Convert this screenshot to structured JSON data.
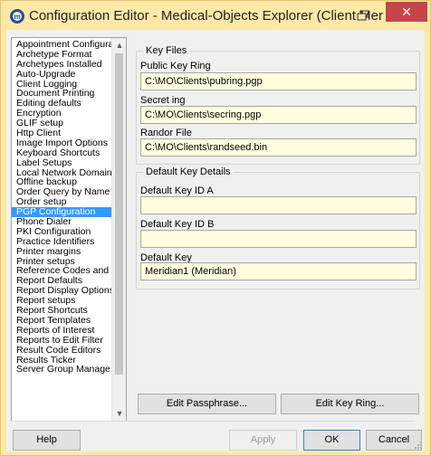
{
  "window": {
    "title": "Configuration Editor - Medical-Objects Explorer (Client Meridia...",
    "close_glyph": "✕"
  },
  "list": {
    "items": [
      "Appointment Configura",
      "Archetype Format",
      "Archetypes Installed",
      "Auto-Upgrade",
      "Client Logging",
      "Document Printing",
      "Editing defaults",
      "Encryption",
      "GLIF setup",
      "Http Client",
      "Image Import Options",
      "Keyboard Shortcuts",
      "Label Setups",
      "Local Network Domain",
      "Offline backup",
      "Order Query by Name",
      "Order setup",
      "PGP Configuration",
      "Phone Dialer",
      "PKI Configuration",
      "Practice Identifiers",
      "Printer margins",
      "Printer setups",
      "Reference Codes and",
      "Report Defaults",
      "Report Display Options",
      "Report setups",
      "Report Shortcuts",
      "Report Templates",
      "Reports of Interest",
      "Reports to Edit Filter",
      "Result Code Editors",
      "Results Ticker",
      "Server Group Manage"
    ],
    "selected": "PGP Configuration"
  },
  "key_files": {
    "title": "Key Files",
    "public_label": "Public Key Ring",
    "public_value": "C:\\MO\\Clients\\pubring.pgp",
    "secret_label": "Secret ing",
    "secret_value": "C:\\MO\\Clients\\secring.pgp",
    "random_label": "Randor File",
    "random_value": "C:\\MO\\Clients\\randseed.bin"
  },
  "default_key": {
    "title": "Default Key Details",
    "id_a_label": "Default Key ID A",
    "id_a_value": "",
    "id_b_label": "Default Key ID B",
    "id_b_value": "",
    "key_label": "Default Key",
    "key_value": "Meridian1 (Meridian)"
  },
  "buttons": {
    "edit_passphrase": "Edit Passphrase...",
    "edit_key_ring": "Edit Key Ring...",
    "help": "Help",
    "apply": "Apply",
    "ok": "OK",
    "cancel": "Cancel"
  },
  "colors": {
    "title_bar": "#fde8a8",
    "close_button": "#c7454a",
    "selection": "#3399ff",
    "input_background": "#ffffe0"
  },
  "icons": [
    "app-logo-icon",
    "restore-window-icon",
    "close-icon",
    "scroll-up-icon",
    "scroll-down-icon",
    "size-grip-icon"
  ]
}
